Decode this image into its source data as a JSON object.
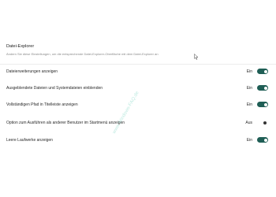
{
  "section": {
    "title": "Datei-Explorer",
    "description": "Ändern Sie diese Einstellungen, um die entsprechende Datei-Explorer-Oberfläche mit dem Datei-Explorer an"
  },
  "rows": [
    {
      "label": "Dateierweiterungen anzeigen",
      "state": "Ein",
      "on": true
    },
    {
      "label": "Ausgeblendete Dateien und Systemdateien einblenden",
      "state": "Ein",
      "on": true
    },
    {
      "label": "Vollständigen Pfad in Titelleiste anzeigen",
      "state": "Ein",
      "on": true
    },
    {
      "label": "Option zum Ausführen als anderer Benutzer im Startmenü anzeigen",
      "state": "Aus",
      "on": false
    },
    {
      "label": "Leere Laufwerke anzeigen",
      "state": "Ein",
      "on": true
    }
  ],
  "watermark": "www.Windows-FAQ.de",
  "colors": {
    "toggle_on": "#1f5e55",
    "toggle_off": "#333333"
  }
}
